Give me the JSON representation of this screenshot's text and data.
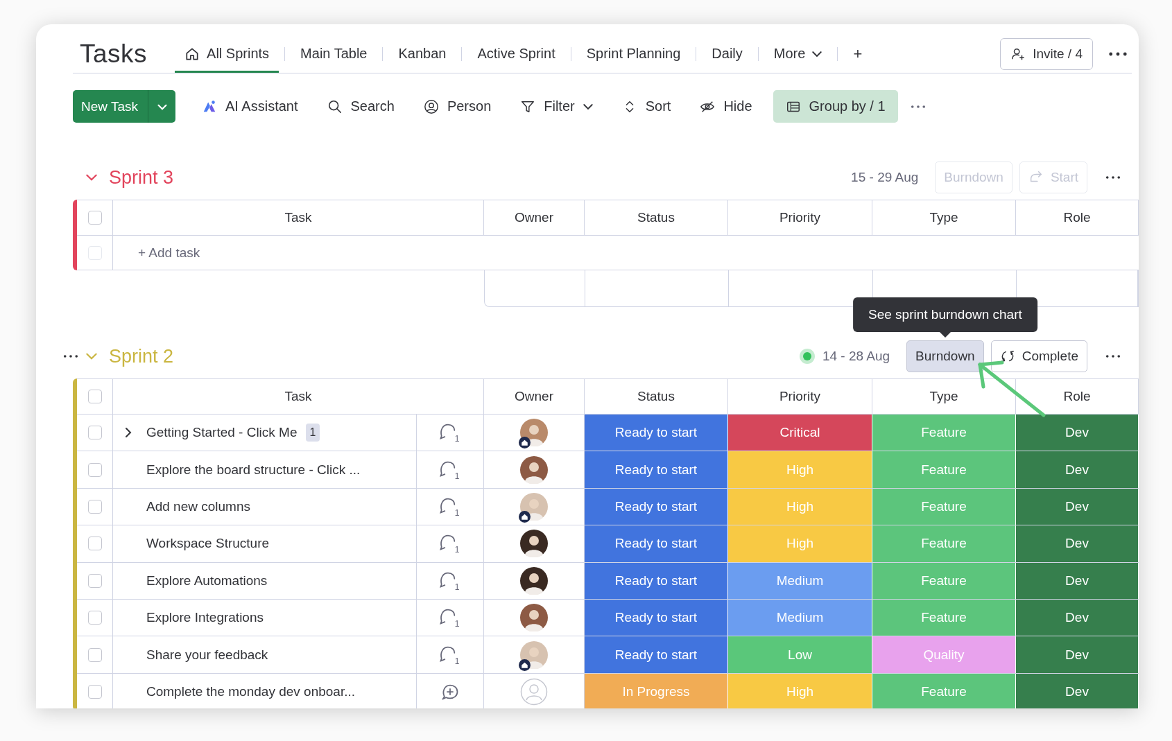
{
  "board": {
    "title": "Tasks",
    "tabs": [
      {
        "label": "All Sprints",
        "selected": true
      },
      {
        "label": "Main Table",
        "selected": false
      },
      {
        "label": "Kanban",
        "selected": false
      },
      {
        "label": "Active Sprint",
        "selected": false
      },
      {
        "label": "Sprint Planning",
        "selected": false
      },
      {
        "label": "Daily",
        "selected": false
      },
      {
        "label": "More",
        "selected": false,
        "dropdown": true
      }
    ],
    "add_tab": "+",
    "invite": "Invite / 4"
  },
  "toolbar": {
    "new_task": "New Task",
    "items": [
      {
        "label": "AI Assistant",
        "active": false
      },
      {
        "label": "Search",
        "active": false
      },
      {
        "label": "Person",
        "active": false
      },
      {
        "label": "Filter",
        "active": false,
        "dropdown": true
      },
      {
        "label": "Sort",
        "active": false
      },
      {
        "label": "Hide",
        "active": false
      },
      {
        "label": "Group by / 1",
        "active": true
      }
    ]
  },
  "sprints": [
    {
      "name": "Sprint 3",
      "color": "#e2445c",
      "active": false,
      "row_menu": false,
      "dates": "15 - 29 Aug",
      "buttons": [
        {
          "kind": "burndown",
          "label": "Burndown",
          "disabled": true,
          "hovered": false
        },
        {
          "kind": "start",
          "label": "Start",
          "disabled": true,
          "hovered": false
        }
      ],
      "columns": [
        "Task",
        "Owner",
        "Status",
        "Priority",
        "Type",
        "Role"
      ],
      "all_checked": false,
      "add_task": "+ Add task",
      "add_checked": false
    },
    {
      "name": "Sprint 2",
      "color": "#cab641",
      "active": true,
      "row_menu": true,
      "dates": "14 - 28 Aug",
      "tooltip": "See sprint burndown chart",
      "buttons": [
        {
          "kind": "burndown",
          "label": "Burndown",
          "disabled": false,
          "hovered": true
        },
        {
          "kind": "complete",
          "label": "Complete",
          "disabled": false,
          "hovered": false
        }
      ],
      "columns": [
        "Task",
        "Owner",
        "Status",
        "Priority",
        "Type",
        "Role"
      ],
      "all_checked": false,
      "rows": [
        {
          "task": "Getting Started - Click Me",
          "checked": false,
          "subitems": "1",
          "comments": "1",
          "owner": {
            "kind": "photo",
            "guest": true
          },
          "status": {
            "text": "Ready to start",
            "color": "#4174de"
          },
          "priority": {
            "text": "Critical",
            "color": "#d5475b"
          },
          "type": {
            "text": "Feature",
            "color": "#5cc57c"
          },
          "role": {
            "text": "Dev",
            "color": "#367f4d"
          }
        },
        {
          "task": "Explore the board structure - Click ...",
          "checked": false,
          "comments": "1",
          "owner": {
            "kind": "photo",
            "guest": false
          },
          "status": {
            "text": "Ready to start",
            "color": "#4174de"
          },
          "priority": {
            "text": "High",
            "color": "#f8c944"
          },
          "type": {
            "text": "Feature",
            "color": "#5cc57c"
          },
          "role": {
            "text": "Dev",
            "color": "#367f4d"
          }
        },
        {
          "task": "Add new columns",
          "checked": false,
          "comments": "1",
          "owner": {
            "kind": "photo",
            "guest": true
          },
          "status": {
            "text": "Ready to start",
            "color": "#4174de"
          },
          "priority": {
            "text": "High",
            "color": "#f8c944"
          },
          "type": {
            "text": "Feature",
            "color": "#5cc57c"
          },
          "role": {
            "text": "Dev",
            "color": "#367f4d"
          }
        },
        {
          "task": "Workspace Structure",
          "checked": false,
          "comments": "1",
          "owner": {
            "kind": "photo",
            "guest": false
          },
          "status": {
            "text": "Ready to start",
            "color": "#4174de"
          },
          "priority": {
            "text": "High",
            "color": "#f8c944"
          },
          "type": {
            "text": "Feature",
            "color": "#5cc57c"
          },
          "role": {
            "text": "Dev",
            "color": "#367f4d"
          }
        },
        {
          "task": "Explore Automations",
          "checked": false,
          "comments": "1",
          "owner": {
            "kind": "photo",
            "guest": false
          },
          "status": {
            "text": "Ready to start",
            "color": "#4174de"
          },
          "priority": {
            "text": "Medium",
            "color": "#6b9df0"
          },
          "type": {
            "text": "Feature",
            "color": "#5cc57c"
          },
          "role": {
            "text": "Dev",
            "color": "#367f4d"
          }
        },
        {
          "task": "Explore Integrations",
          "checked": false,
          "comments": "1",
          "owner": {
            "kind": "photo",
            "guest": false
          },
          "status": {
            "text": "Ready to start",
            "color": "#4174de"
          },
          "priority": {
            "text": "Medium",
            "color": "#6b9df0"
          },
          "type": {
            "text": "Feature",
            "color": "#5cc57c"
          },
          "role": {
            "text": "Dev",
            "color": "#367f4d"
          }
        },
        {
          "task": "Share your feedback",
          "checked": false,
          "comments": "1",
          "owner": {
            "kind": "photo",
            "guest": true
          },
          "status": {
            "text": "Ready to start",
            "color": "#4174de"
          },
          "priority": {
            "text": "Low",
            "color": "#5ac77a"
          },
          "type": {
            "text": "Quality",
            "color": "#e8a2ed"
          },
          "role": {
            "text": "Dev",
            "color": "#367f4d"
          }
        },
        {
          "task": "Complete the monday dev onboar...",
          "checked": false,
          "owner": {
            "kind": "empty",
            "guest": false
          },
          "status": {
            "text": "In Progress",
            "color": "#f1ac55"
          },
          "priority": {
            "text": "High",
            "color": "#f8c944"
          },
          "type": {
            "text": "Feature",
            "color": "#5cc57c"
          },
          "role": {
            "text": "Dev",
            "color": "#367f4d"
          }
        }
      ]
    }
  ]
}
